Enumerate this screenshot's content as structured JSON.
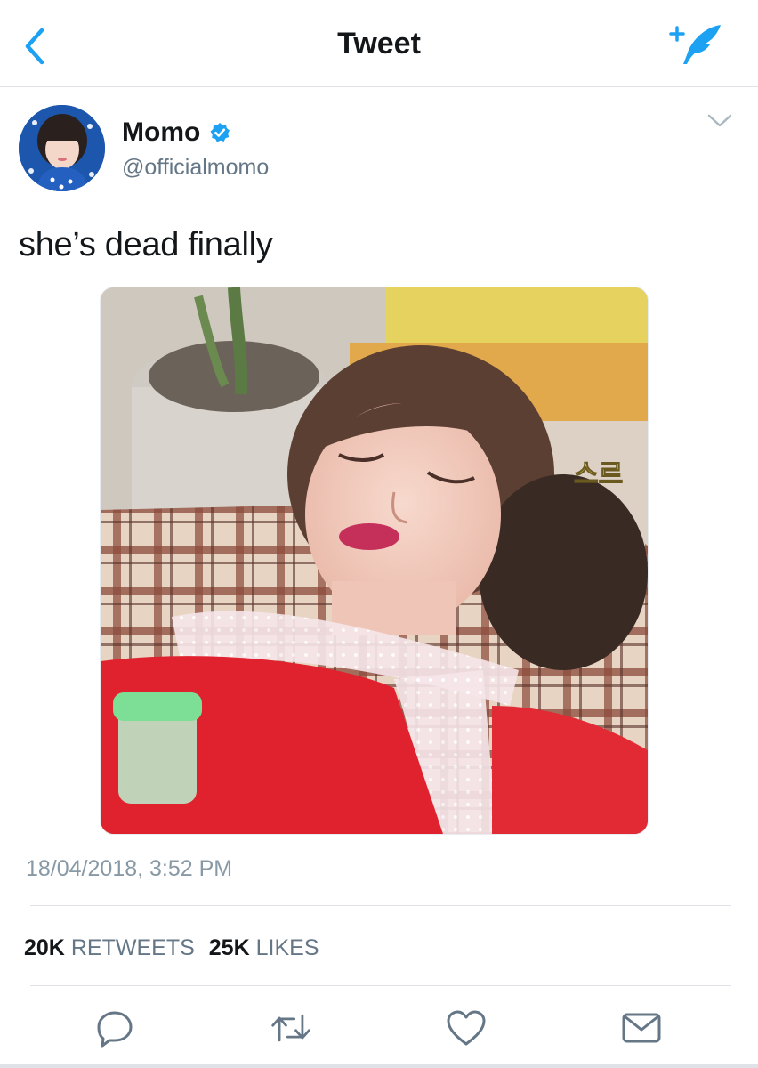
{
  "nav": {
    "title": "Tweet",
    "back_icon": "chevron-left-icon",
    "compose_icon": "compose-feather-icon",
    "accent_color": "#1da1f2"
  },
  "tweet": {
    "user": {
      "name": "Momo",
      "handle": "@officialmomo",
      "verified": true
    },
    "text": "she’s dead finally",
    "media_overlay_text": "스르",
    "timestamp": "18/04/2018, 3:52 PM",
    "stats": {
      "retweets_count": "20K",
      "retweets_label": "RETWEETS",
      "likes_count": "25K",
      "likes_label": "LIKES"
    },
    "actions": [
      "reply-icon",
      "retweet-icon",
      "like-icon",
      "share-icon"
    ]
  }
}
